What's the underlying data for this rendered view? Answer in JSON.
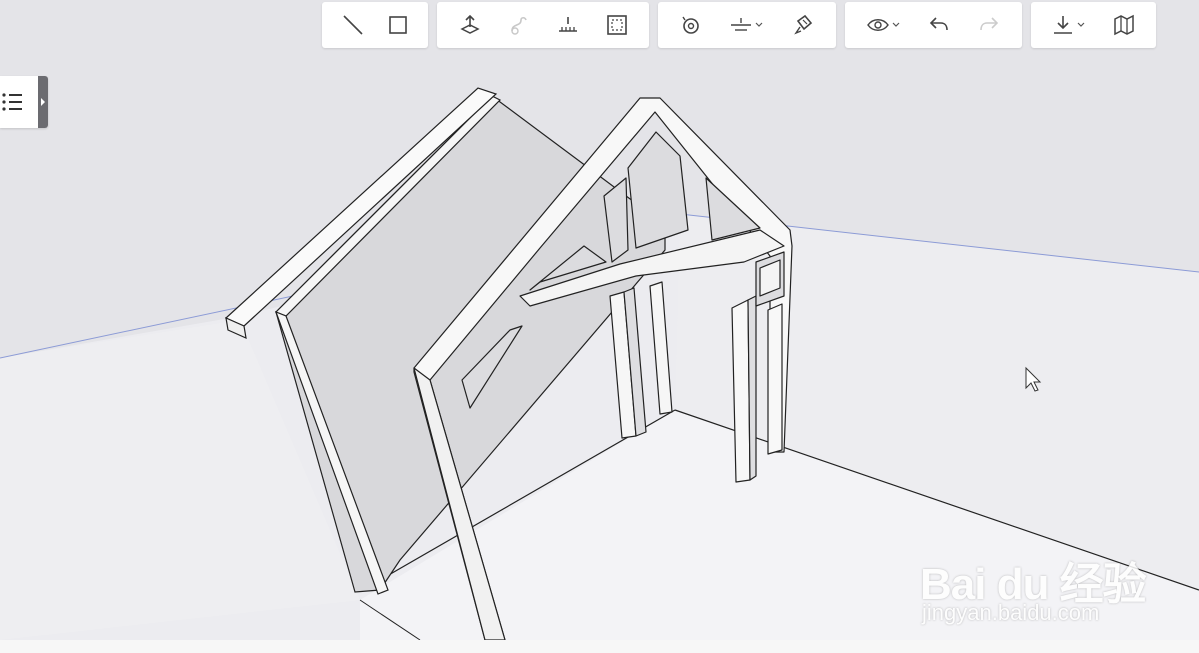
{
  "toolbar": {
    "groups": [
      {
        "name": "draw",
        "tools": [
          {
            "id": "line",
            "icon": "line-icon",
            "label": "Line"
          },
          {
            "id": "rectangle",
            "icon": "rectangle-icon",
            "label": "Rectangle"
          }
        ]
      },
      {
        "name": "modify",
        "tools": [
          {
            "id": "push-pull",
            "icon": "push-pull-icon",
            "label": "Push/Pull"
          },
          {
            "id": "follow-me",
            "icon": "follow-me-icon",
            "label": "Follow Me",
            "disabled": true
          },
          {
            "id": "tape",
            "icon": "tape-measure-icon",
            "label": "Tape Measure"
          },
          {
            "id": "offset",
            "icon": "offset-icon",
            "label": "Offset"
          }
        ]
      },
      {
        "name": "tools",
        "tools": [
          {
            "id": "orbit",
            "icon": "orbit-icon",
            "label": "Orbit"
          },
          {
            "id": "section",
            "icon": "section-plane-icon",
            "label": "Section",
            "dropdown": true
          },
          {
            "id": "paint",
            "icon": "paint-bucket-icon",
            "label": "Paint"
          }
        ]
      },
      {
        "name": "view",
        "tools": [
          {
            "id": "view",
            "icon": "eye-icon",
            "label": "View",
            "dropdown": true
          },
          {
            "id": "undo",
            "icon": "undo-icon",
            "label": "Undo"
          },
          {
            "id": "redo",
            "icon": "redo-icon",
            "label": "Redo",
            "disabled": true
          }
        ]
      },
      {
        "name": "file",
        "tools": [
          {
            "id": "download",
            "icon": "download-icon",
            "label": "Download",
            "dropdown": true
          },
          {
            "id": "map",
            "icon": "map-icon",
            "label": "Map"
          }
        ]
      }
    ]
  },
  "outliner": {
    "icon": "list-icon",
    "handle_icon": "caret-right-icon"
  },
  "watermark": {
    "logo": "Bai du 经验",
    "url": "jingyan.baidu.com"
  },
  "colors": {
    "background": "#e4e4e8",
    "ground": "#eaeaee",
    "horizon_line": "#8c9bd6",
    "wall_face": "#f8f8f8",
    "wall_shadow": "#d9d9dc",
    "edge": "#222222"
  }
}
